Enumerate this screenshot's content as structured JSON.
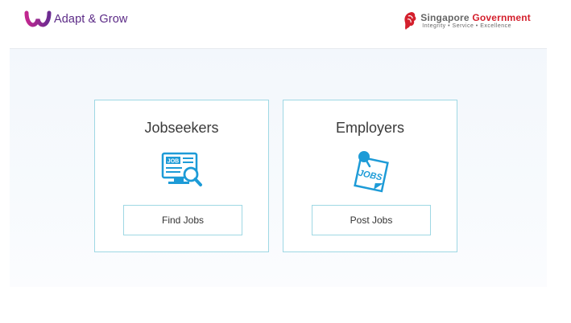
{
  "brand": {
    "name": "Adapt & Grow",
    "logo_icon": "adapt-grow-logo-icon",
    "color": "#5b2a86"
  },
  "government": {
    "title_part1": "Singapore",
    "title_part2": "Government",
    "tagline": "Integrity • Service • Excellence",
    "logo_icon": "lion-head-icon",
    "accent": "#d4202d"
  },
  "cards": {
    "jobseekers": {
      "title": "Jobseekers",
      "icon": "job-search-icon",
      "button_label": "Find Jobs"
    },
    "employers": {
      "title": "Employers",
      "icon": "jobs-note-icon",
      "button_label": "Post Jobs"
    }
  },
  "colors": {
    "icon_blue": "#1d9bd7",
    "card_border": "#9fd8e4"
  }
}
